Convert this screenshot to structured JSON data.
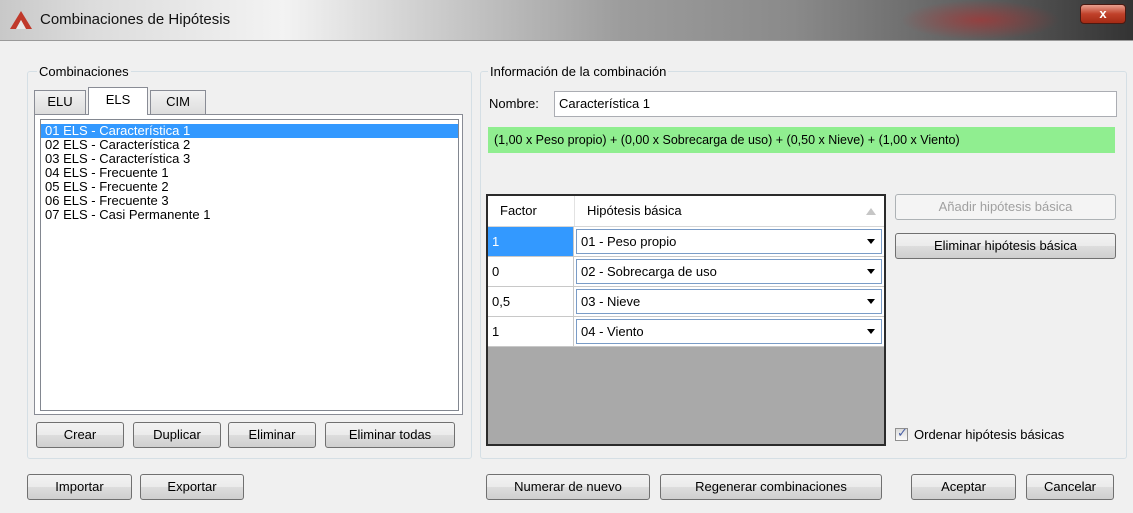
{
  "window": {
    "title": "Combinaciones de Hipótesis",
    "close_label": "x"
  },
  "left_group": {
    "label": "Combinaciones",
    "tabs": [
      {
        "label": "ELU",
        "active": false
      },
      {
        "label": "ELS",
        "active": true
      },
      {
        "label": "CIM",
        "active": false
      }
    ],
    "items": [
      "01 ELS - Característica 1",
      "02 ELS - Característica 2",
      "03 ELS - Característica 3",
      "04 ELS - Frecuente 1",
      "05 ELS - Frecuente 2",
      "06 ELS - Frecuente 3",
      "07 ELS - Casi Permanente 1"
    ],
    "selected_index": 0,
    "buttons": {
      "create": "Crear",
      "duplicate": "Duplicar",
      "delete": "Eliminar",
      "delete_all": "Eliminar todas"
    }
  },
  "info_group": {
    "label": "Información de la combinación",
    "name_label": "Nombre:",
    "name_value": "Característica 1",
    "formula": "(1,00 x Peso propio) + (0,00 x Sobrecarga de uso) + (0,50 x Nieve) + (1,00 x Viento)",
    "grid": {
      "headers": {
        "factor": "Factor",
        "hypothesis": "Hipótesis básica"
      },
      "rows": [
        {
          "factor": "1",
          "hypothesis": "01 - Peso propio"
        },
        {
          "factor": "0",
          "hypothesis": "02 - Sobrecarga de uso"
        },
        {
          "factor": "0,5",
          "hypothesis": "03 - Nieve"
        },
        {
          "factor": "1",
          "hypothesis": "04 - Viento"
        }
      ]
    },
    "add_button": "Añadir hipótesis básica",
    "remove_button": "Eliminar hipótesis básica",
    "sort_checkbox": {
      "label": "Ordenar hipótesis básicas",
      "checked": true
    }
  },
  "footer": {
    "import": "Importar",
    "export": "Exportar",
    "renumber": "Numerar de nuevo",
    "regenerate": "Regenerar combinaciones",
    "accept": "Aceptar",
    "cancel": "Cancelar"
  }
}
